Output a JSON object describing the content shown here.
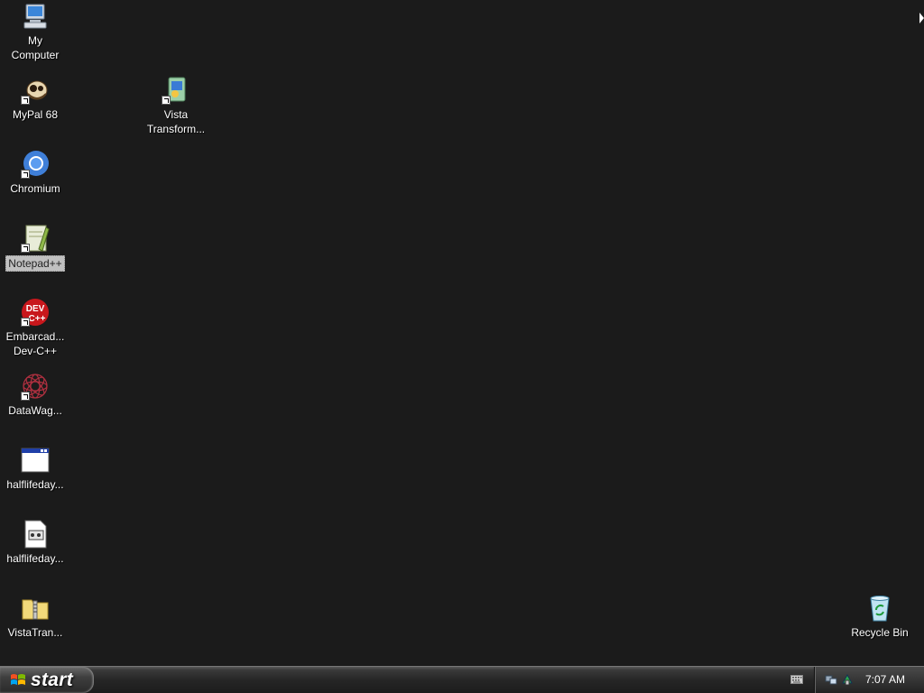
{
  "desktop": {
    "icons": [
      {
        "label": "My\nComputer",
        "icon": "my-computer-icon",
        "shortcut": false
      },
      {
        "label": "MyPal 68",
        "icon": "mypal-browser-icon",
        "shortcut": true
      },
      {
        "label": "Vista\nTransform...",
        "icon": "vista-transformation-icon",
        "shortcut": true
      },
      {
        "label": "Chromium",
        "icon": "chromium-icon",
        "shortcut": true
      },
      {
        "label": "Notepad++",
        "icon": "notepad-plus-plus-icon",
        "shortcut": true,
        "selected": true
      },
      {
        "label": "Embarcad...\nDev-C++",
        "icon": "dev-cpp-icon",
        "shortcut": true
      },
      {
        "label": "DataWag...",
        "icon": "datawag-icon",
        "shortcut": true
      },
      {
        "label": "halflifeday...",
        "icon": "application-window-icon",
        "shortcut": false
      },
      {
        "label": "halflifeday...",
        "icon": "config-file-icon",
        "shortcut": false
      },
      {
        "label": "VistaTran...",
        "icon": "zip-folder-icon",
        "shortcut": false
      },
      {
        "label": "Recycle Bin",
        "icon": "recycle-bin-icon",
        "shortcut": false
      }
    ]
  },
  "taskbar": {
    "start_label": "start",
    "clock": "7:07 AM"
  },
  "colors": {
    "desktop_bg": "#1b1b1b",
    "taskbar_bg": "#262626",
    "label_text": "#ffffff"
  }
}
